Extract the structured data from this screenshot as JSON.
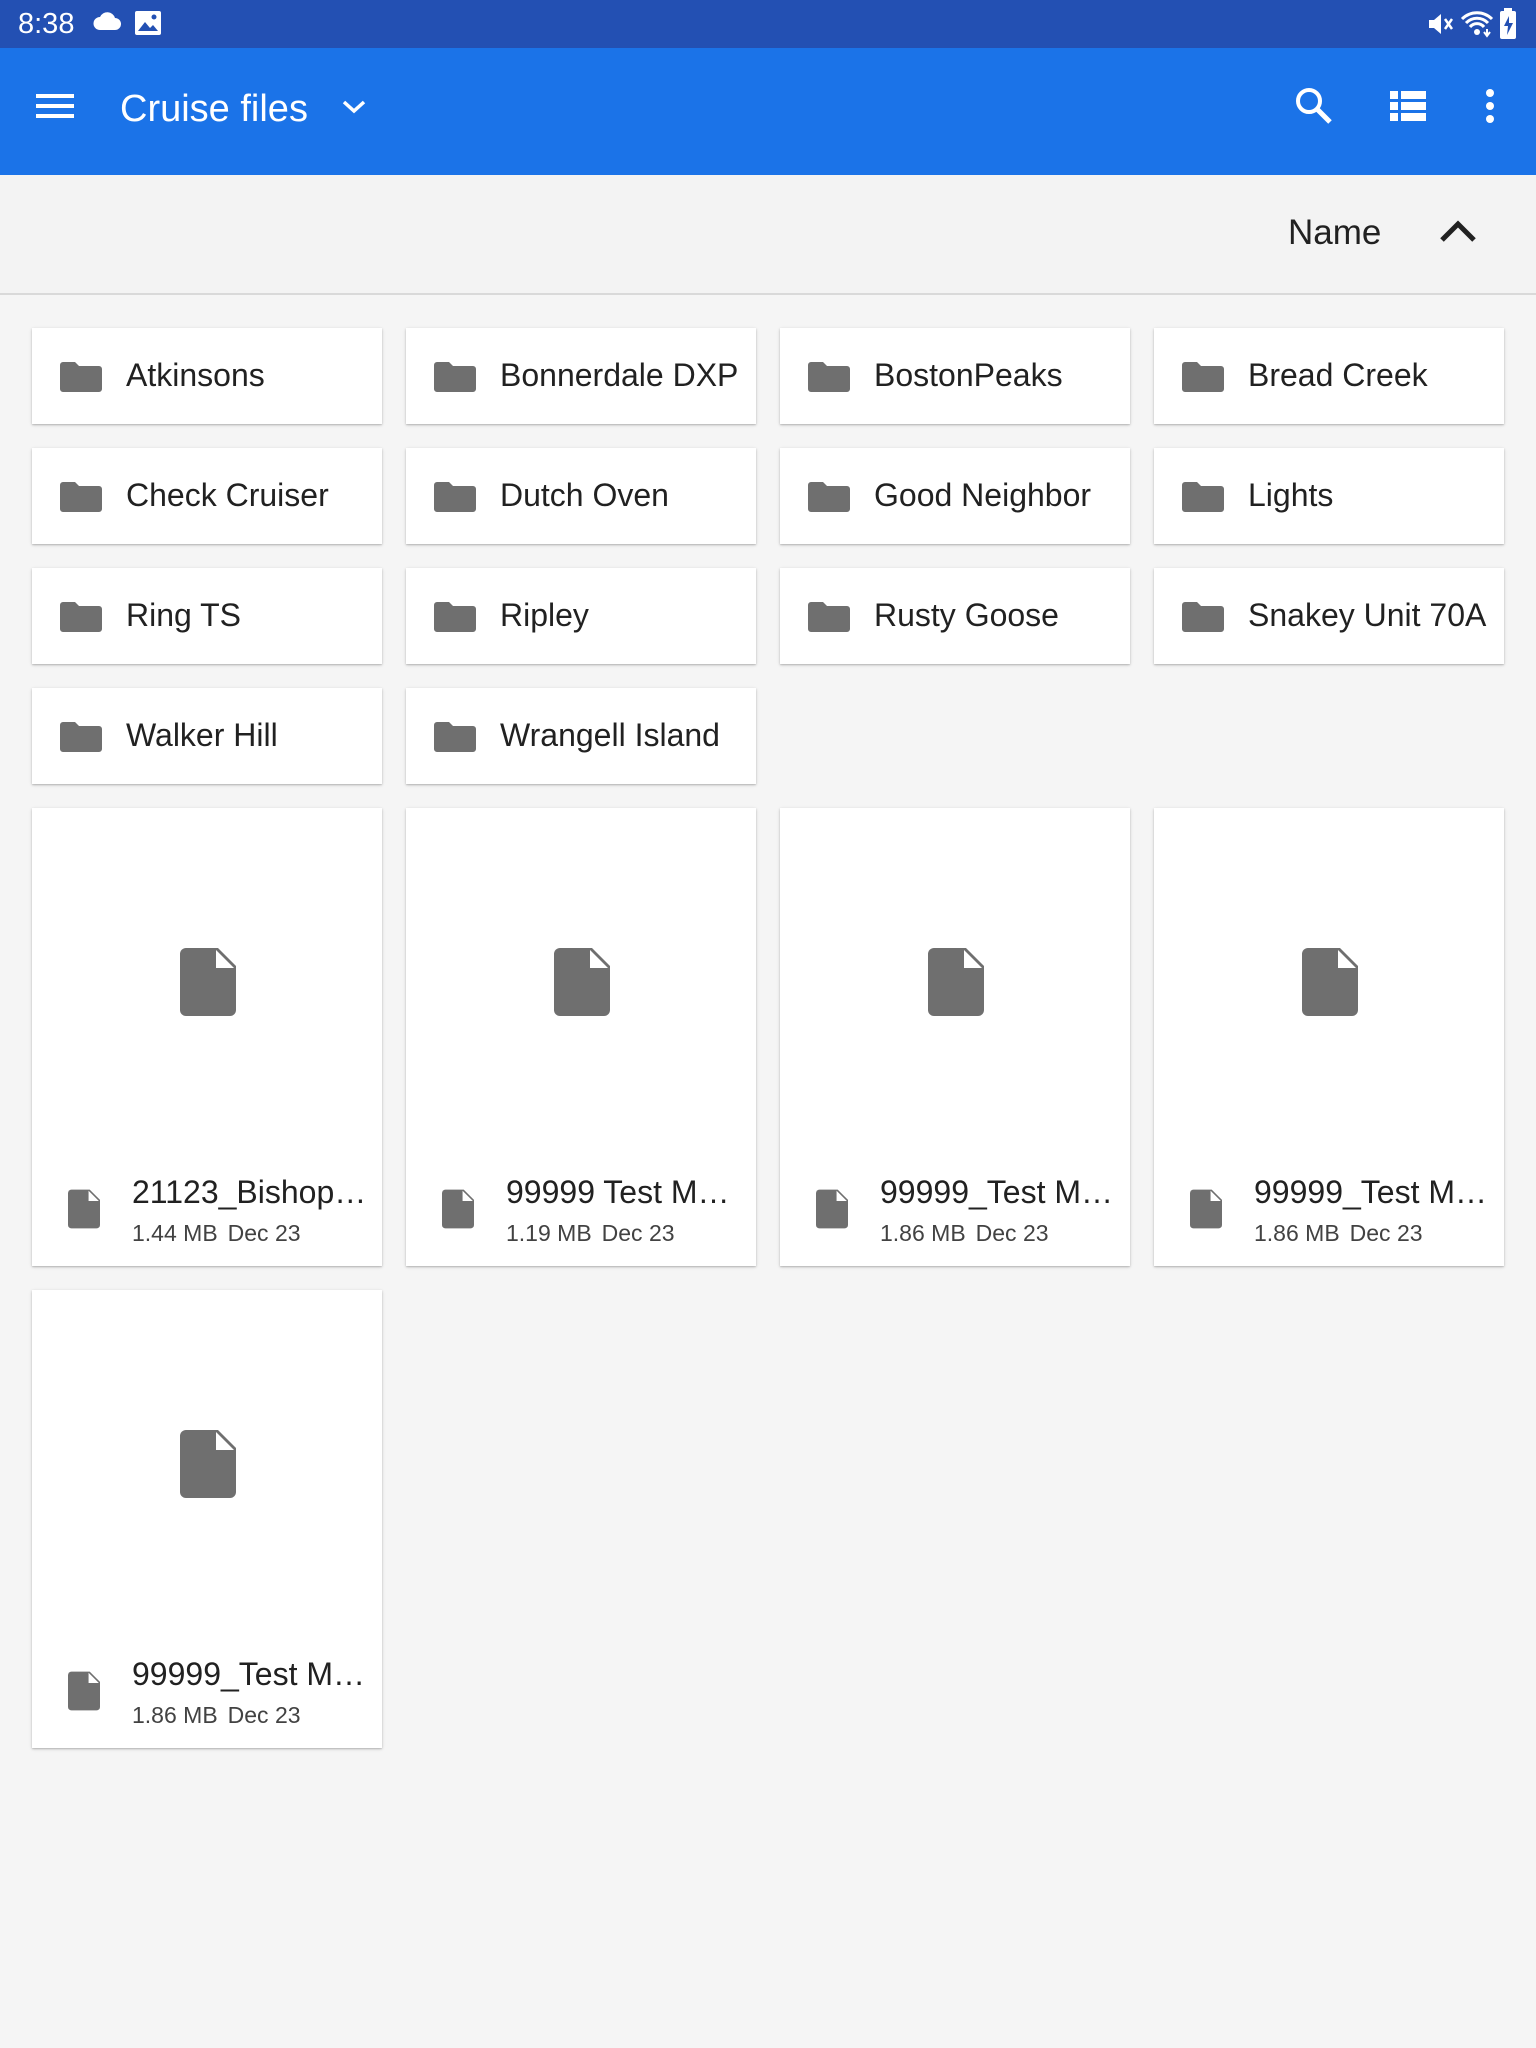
{
  "status_bar": {
    "time": "8:38"
  },
  "app_bar": {
    "title": "Cruise files"
  },
  "sort_bar": {
    "label": "Name"
  },
  "folders": [
    {
      "name": "Atkinsons"
    },
    {
      "name": "Bonnerdale DXP"
    },
    {
      "name": "BostonPeaks"
    },
    {
      "name": "Bread Creek"
    },
    {
      "name": "Check Cruiser"
    },
    {
      "name": "Dutch Oven"
    },
    {
      "name": "Good Neighbor"
    },
    {
      "name": "Lights"
    },
    {
      "name": "Ring TS"
    },
    {
      "name": "Ripley"
    },
    {
      "name": "Rusty Goose"
    },
    {
      "name": "Snakey Unit 70A"
    },
    {
      "name": "Walker Hill"
    },
    {
      "name": "Wrangell Island"
    }
  ],
  "files": [
    {
      "name": "21123_Bishop…",
      "size": "1.44 MB",
      "date": "Dec 23"
    },
    {
      "name": "99999 Test M…",
      "size": "1.19 MB",
      "date": "Dec 23"
    },
    {
      "name": "99999_Test M…",
      "size": "1.86 MB",
      "date": "Dec 23"
    },
    {
      "name": "99999_Test M…",
      "size": "1.86 MB",
      "date": "Dec 23"
    },
    {
      "name": "99999_Test M…",
      "size": "1.86 MB",
      "date": "Dec 23"
    }
  ],
  "colors": {
    "status_bar": "#2350b3",
    "app_bar": "#1b73e8",
    "icon_gray": "#6f6f6f"
  },
  "icons": {
    "status": [
      "cloud-icon",
      "image-icon",
      "vibrate-mute-icon",
      "wifi-icon",
      "battery-charging-icon"
    ],
    "app_bar": [
      "menu-icon",
      "chevron-down-icon",
      "search-icon",
      "list-view-icon",
      "more-vert-icon"
    ],
    "sort": "chevron-up-icon",
    "folder": "folder-icon",
    "file": "file-icon"
  }
}
